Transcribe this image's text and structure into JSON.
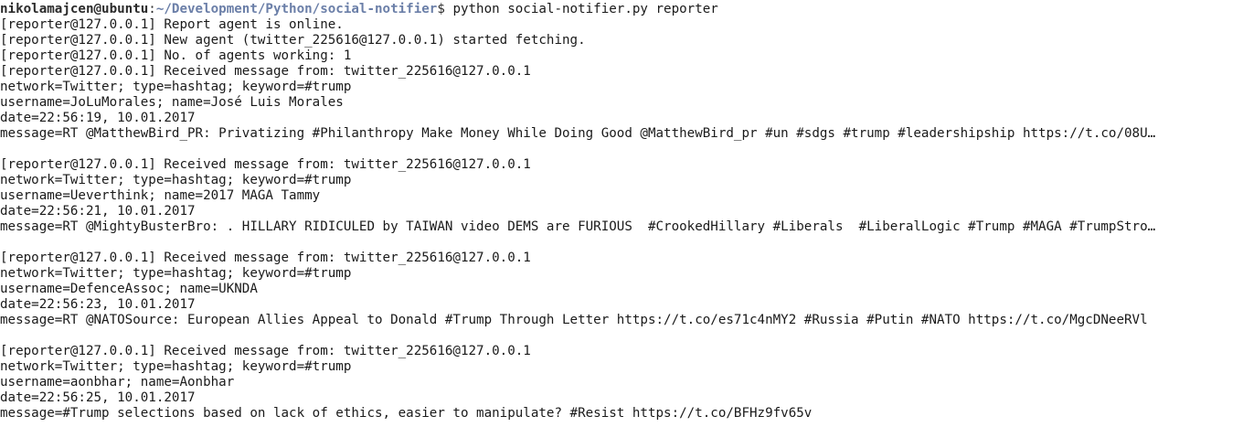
{
  "prompt": {
    "user_host": "nikolamajcen@ubuntu",
    "separator": ":",
    "path": "~/Development/Python/social-notifier",
    "dollar": "$ ",
    "command": "python social-notifier.py reporter"
  },
  "output_lines": [
    "[reporter@127.0.0.1] Report agent is online.",
    "[reporter@127.0.0.1] New agent (twitter_225616@127.0.0.1) started fetching.",
    "[reporter@127.0.0.1] No. of agents working: 1",
    "[reporter@127.0.0.1] Received message from: twitter_225616@127.0.0.1",
    "network=Twitter; type=hashtag; keyword=#trump",
    "username=JoLuMorales; name=José Luis Morales",
    "date=22:56:19, 10.01.2017",
    "message=RT @MatthewBird_PR: Privatizing #Philanthropy Make Money While Doing Good @MatthewBird_pr #un #sdgs #trump #leadershipship https://t.co/08U…",
    "",
    "[reporter@127.0.0.1] Received message from: twitter_225616@127.0.0.1",
    "network=Twitter; type=hashtag; keyword=#trump",
    "username=Ueverthink; name=2017 MAGA Tammy",
    "date=22:56:21, 10.01.2017",
    "message=RT @MightyBusterBro: . HILLARY RIDICULED by TAIWAN video DEMS are FURIOUS  #CrookedHillary #Liberals  #LiberalLogic #Trump #MAGA #TrumpStro…",
    "",
    "[reporter@127.0.0.1] Received message from: twitter_225616@127.0.0.1",
    "network=Twitter; type=hashtag; keyword=#trump",
    "username=DefenceAssoc; name=UKNDA",
    "date=22:56:23, 10.01.2017",
    "message=RT @NATOSource: European Allies Appeal to Donald #Trump Through Letter https://t.co/es71c4nMY2 #Russia #Putin #NATO https://t.co/MgcDNeeRVl",
    "",
    "[reporter@127.0.0.1] Received message from: twitter_225616@127.0.0.1",
    "network=Twitter; type=hashtag; keyword=#trump",
    "username=aonbhar; name=Aonbhar",
    "date=22:56:25, 10.01.2017",
    "message=#Trump selections based on lack of ethics, easier to manipulate? #Resist https://t.co/BFHz9fv65v"
  ]
}
